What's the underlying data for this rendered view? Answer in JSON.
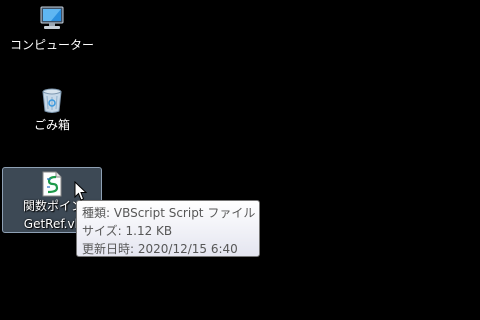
{
  "desktop": {
    "icons": [
      {
        "label": "コンピューター",
        "icon": "computer-icon"
      },
      {
        "label": "ごみ箱",
        "icon": "recycle-bin-icon"
      },
      {
        "label_line1": "関数ポイン",
        "label_line2": "GetRef.vb",
        "icon": "vbscript-file-icon",
        "selected": true
      }
    ]
  },
  "tooltip": {
    "type_line": "種類: VBScript Script ファイル",
    "size_line": "サイズ: 1.12 KB",
    "date_line": "更新日時: 2020/12/15 6:40"
  },
  "colors": {
    "background": "#000000",
    "selection_fill": "#70859b",
    "tooltip_text": "#575757"
  }
}
